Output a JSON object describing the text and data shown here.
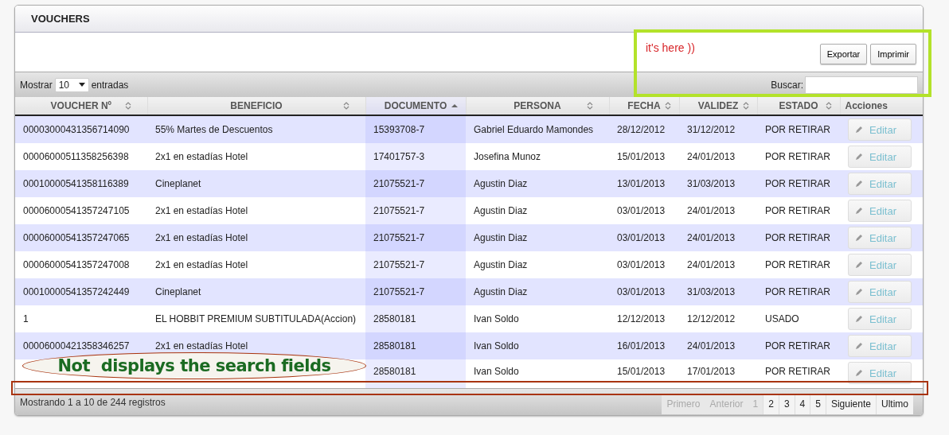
{
  "panel": {
    "title": "VOUCHERS"
  },
  "toolbar": {
    "buttons": [
      "Exportar",
      "Imprimir"
    ]
  },
  "length_control": {
    "before": "Mostrar",
    "value": "10",
    "after": "entradas"
  },
  "search": {
    "label": "Buscar:"
  },
  "columns": [
    {
      "label": "VOUCHER Nº",
      "sortable": true,
      "sorted": false
    },
    {
      "label": "BENEFICIO",
      "sortable": true,
      "sorted": false
    },
    {
      "label": "DOCUMENTO",
      "sortable": true,
      "sorted": true
    },
    {
      "label": "PERSONA",
      "sortable": true,
      "sorted": false
    },
    {
      "label": "FECHA",
      "sortable": true,
      "sorted": false
    },
    {
      "label": "VALIDEZ",
      "sortable": true,
      "sorted": false
    },
    {
      "label": "ESTADO",
      "sortable": true,
      "sorted": false
    },
    {
      "label": "Acciones",
      "sortable": false,
      "sorted": false
    }
  ],
  "rows": [
    {
      "cells": [
        "00003000431356714090",
        "55% Martes de Descuentos",
        "15393708-7",
        "Gabriel Eduardo Mamondes",
        "28/12/2012",
        "31/12/2012",
        "POR RETIRAR"
      ],
      "action": "Editar"
    },
    {
      "cells": [
        "00006000511358256398",
        "2x1 en estadías Hotel",
        "17401757-3",
        "Josefina Munoz",
        "15/01/2013",
        "24/01/2013",
        "POR RETIRAR"
      ],
      "action": "Editar"
    },
    {
      "cells": [
        "00010000541358116389",
        "Cineplanet",
        "21075521-7",
        "Agustin Diaz",
        "13/01/2013",
        "31/03/2013",
        "POR RETIRAR"
      ],
      "action": "Editar"
    },
    {
      "cells": [
        "00006000541357247105",
        "2x1 en estadías Hotel",
        "21075521-7",
        "Agustin Diaz",
        "03/01/2013",
        "24/01/2013",
        "POR RETIRAR"
      ],
      "action": "Editar"
    },
    {
      "cells": [
        "00006000541357247065",
        "2x1 en estadías Hotel",
        "21075521-7",
        "Agustin Diaz",
        "03/01/2013",
        "24/01/2013",
        "POR RETIRAR"
      ],
      "action": "Editar"
    },
    {
      "cells": [
        "00006000541357247008",
        "2x1 en estadías Hotel",
        "21075521-7",
        "Agustin Diaz",
        "03/01/2013",
        "24/01/2013",
        "POR RETIRAR"
      ],
      "action": "Editar"
    },
    {
      "cells": [
        "00010000541357242449",
        "Cineplanet",
        "21075521-7",
        "Agustin Diaz",
        "03/01/2013",
        "31/03/2013",
        "POR RETIRAR"
      ],
      "action": "Editar"
    },
    {
      "cells": [
        "1",
        "EL HOBBIT PREMIUM SUBTITULADA(Accion)",
        "28580181",
        "Ivan Soldo",
        "12/12/2013",
        "12/12/2012",
        "USADO"
      ],
      "action": "Editar"
    },
    {
      "cells": [
        "00006000421358346257",
        "2x1 en estadías Hotel",
        "28580181",
        "Ivan Soldo",
        "16/01/2013",
        "24/01/2013",
        "POR RETIRAR"
      ],
      "action": "Editar"
    },
    {
      "cells": [
        "",
        "",
        "28580181",
        "Ivan Soldo",
        "15/01/2013",
        "17/01/2013",
        "POR RETIRAR"
      ],
      "action": "Editar"
    }
  ],
  "info": "Mostrando 1 a 10 de 244 registros",
  "pagination": [
    {
      "label": "Primero",
      "disabled": true
    },
    {
      "label": "Anterior",
      "disabled": true
    },
    {
      "label": "1",
      "disabled": true
    },
    {
      "label": "2",
      "disabled": false
    },
    {
      "label": "3",
      "disabled": false
    },
    {
      "label": "4",
      "disabled": false
    },
    {
      "label": "5",
      "disabled": false
    },
    {
      "label": "Siguiente",
      "disabled": false
    },
    {
      "label": "Ultimo",
      "disabled": false
    }
  ],
  "annotations": [
    {
      "kind": "frame",
      "color": "#b3e22a"
    },
    {
      "kind": "note",
      "text": "it's here ))",
      "color": "#d8262a"
    },
    {
      "kind": "frame",
      "color": "#a83410"
    },
    {
      "kind": "callout",
      "text": "Not  displays the search fields",
      "color": "#a83410"
    }
  ]
}
